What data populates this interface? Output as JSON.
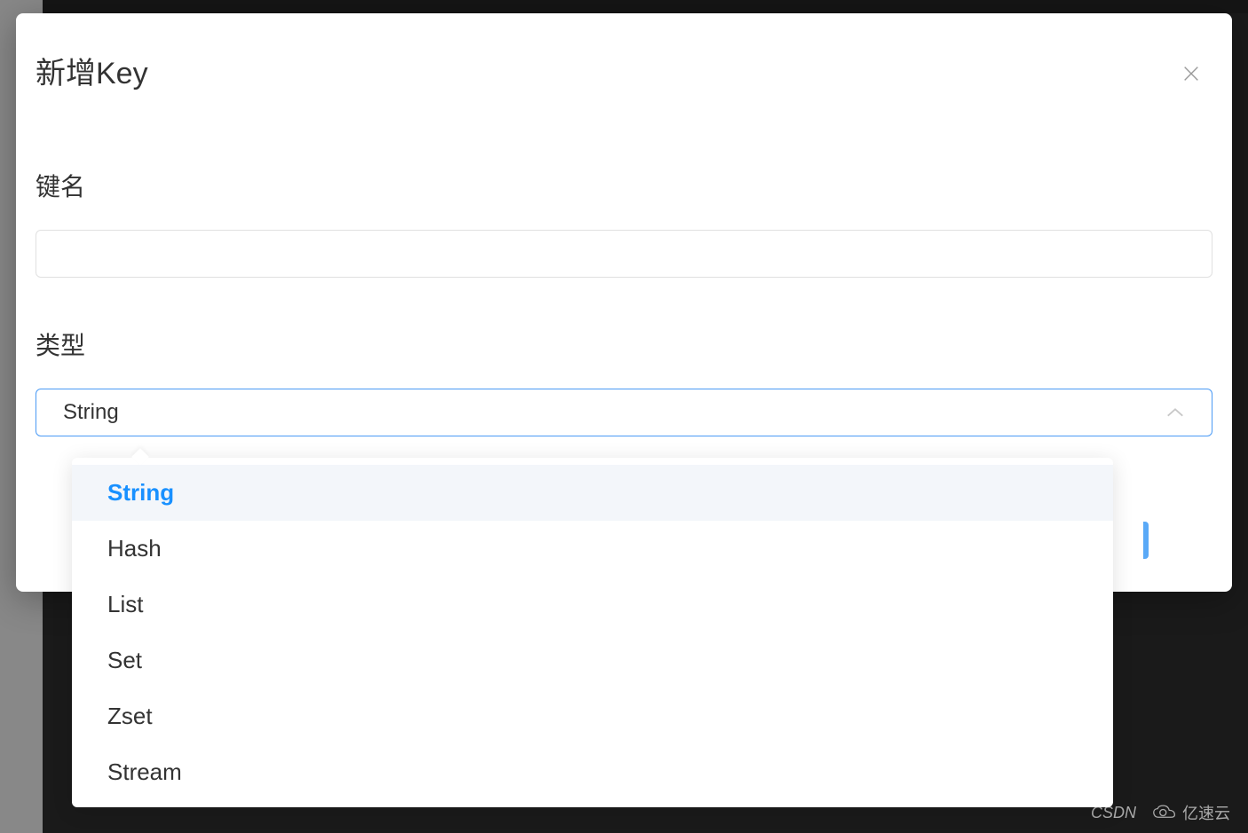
{
  "modal": {
    "title": "新增Key",
    "key_name_label": "键名",
    "key_name_value": "",
    "type_label": "类型",
    "selected_type": "String",
    "type_options": {
      "0": "String",
      "1": "Hash",
      "2": "List",
      "3": "Set",
      "4": "Zset",
      "5": "Stream"
    }
  },
  "watermark": {
    "left": "CSDN",
    "right": "亿速云"
  }
}
